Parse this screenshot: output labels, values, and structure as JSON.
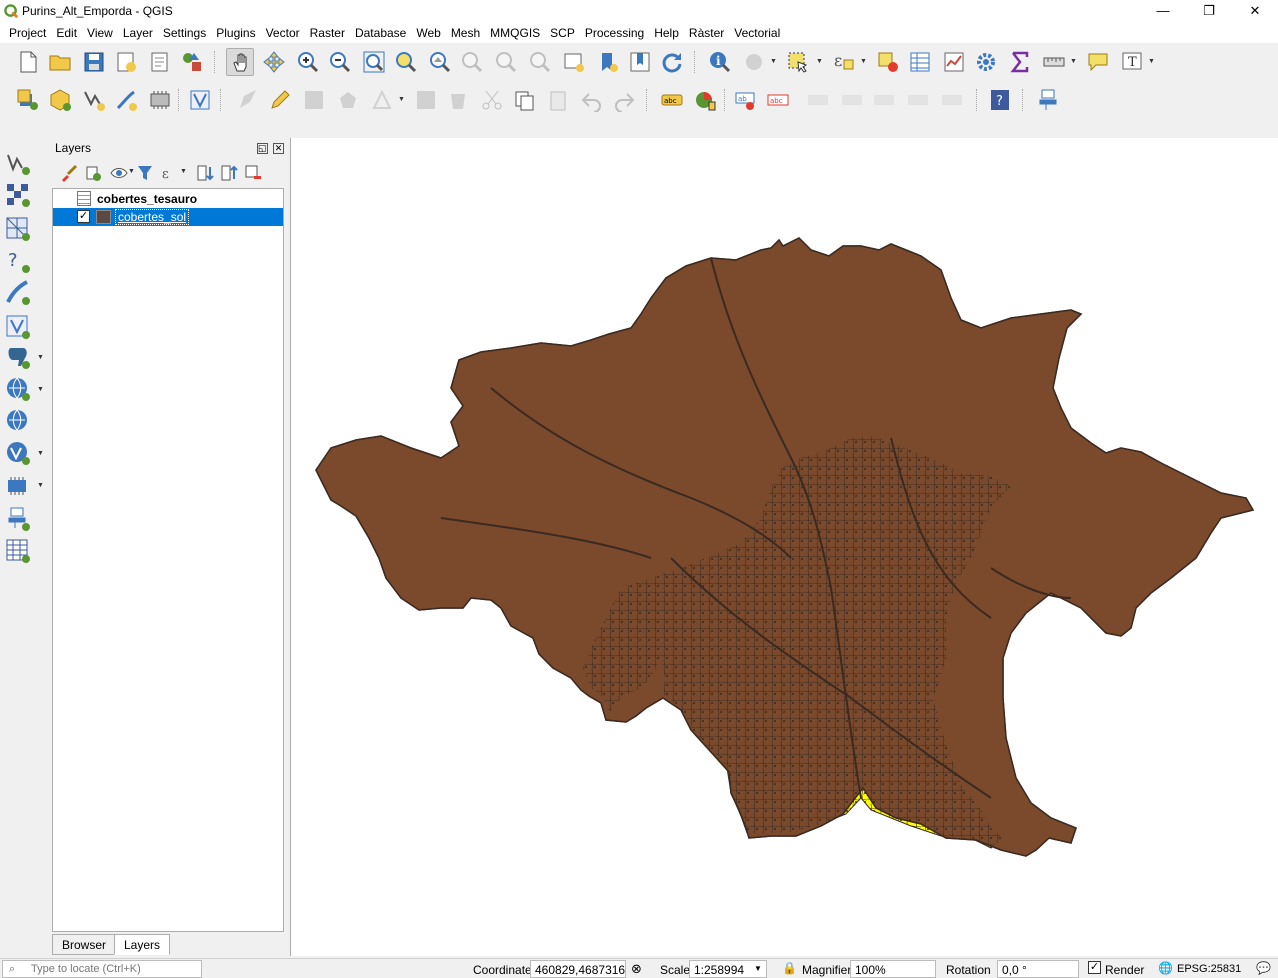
{
  "window": {
    "title": "Purins_Alt_Emporda - QGIS",
    "minimize": "—",
    "restore": "❐",
    "close": "✕"
  },
  "menu": [
    "Project",
    "Edit",
    "View",
    "Layer",
    "Settings",
    "Plugins",
    "Vector",
    "Raster",
    "Database",
    "Web",
    "Mesh",
    "MMQGIS",
    "SCP",
    "Processing",
    "Help",
    "Ràster",
    "Vectorial"
  ],
  "panel": {
    "title": "Layers",
    "layers": [
      {
        "name": "cobertes_tesauro",
        "type": "table",
        "selected": false
      },
      {
        "name": "cobertes_sol",
        "type": "polygon",
        "checked": true,
        "selected": true
      }
    ],
    "tabs": [
      "Browser",
      "Layers"
    ],
    "active_tab": "Layers"
  },
  "map": {
    "fill_brown": "#7b4a2d",
    "fill_yellow": "#ffff00",
    "outline": "#3a2a20"
  },
  "status": {
    "locator_placeholder": "Type to locate (Ctrl+K)",
    "coordinate_label": "Coordinate",
    "coordinate_value": "460829,4687316",
    "scale_label": "Scale",
    "scale_value": "1:258994",
    "magnifier_label": "Magnifier",
    "magnifier_value": "100%",
    "rotation_label": "Rotation",
    "rotation_value": "0,0 °",
    "render_label": "Render",
    "crs": "EPSG:25831"
  }
}
